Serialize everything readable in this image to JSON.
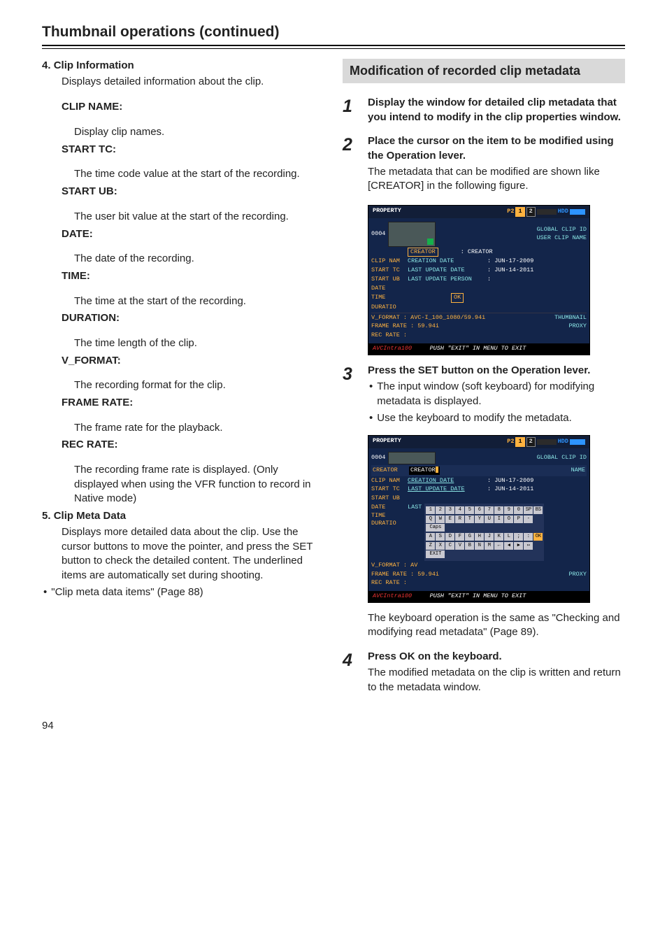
{
  "chapterTitle": "Thumbnail operations (continued)",
  "left": {
    "item4": {
      "num": "4.",
      "title": "Clip Information",
      "desc": "Displays detailed information about the clip.",
      "fields": [
        {
          "label": "CLIP NAME:",
          "text": "Display clip names."
        },
        {
          "label": "START TC:",
          "text": "The time code value at the start of the recording."
        },
        {
          "label": "START UB:",
          "text": "The user bit value at the start of the recording."
        },
        {
          "label": "DATE:",
          "text": "The date of the recording."
        },
        {
          "label": "TIME:",
          "text": "The time at the start of the recording."
        },
        {
          "label": "DURATION:",
          "text": "The time length of the clip."
        },
        {
          "label": "V_FORMAT:",
          "text": "The recording format for the clip."
        },
        {
          "label": "FRAME RATE:",
          "text": "The frame rate for the playback."
        },
        {
          "label": "REC RATE:",
          "text": "The recording frame rate is displayed. (Only displayed when using the VFR function to record in Native mode)"
        }
      ]
    },
    "item5": {
      "num": "5.",
      "title": "Clip Meta Data",
      "desc": "Displays more detailed data about the clip. Use the cursor buttons to move the pointer, and press the SET button to check the detailed content. The underlined items are automatically set during shooting.",
      "bulletText": "\"Clip meta data items\" (Page 88)"
    }
  },
  "right": {
    "sectionHeading": "Modification of recorded clip metadata",
    "steps": {
      "s1": {
        "num": "1",
        "title": "Display the window for detailed clip metadata that you intend to modify in the clip properties window."
      },
      "s2": {
        "num": "2",
        "title": "Place the cursor on the item to be modified using the Operation lever.",
        "para": "The metadata that can be modified are shown like [CREATOR] in the following figure."
      },
      "s3": {
        "num": "3",
        "title": "Press the SET button on the Operation lever.",
        "bullets": [
          "The input window (soft keyboard) for modifying metadata is displayed.",
          "Use the keyboard to modify the metadata."
        ],
        "after": "The keyboard operation is the same as \"Checking and modifying read metadata\" (Page 89)."
      },
      "s4": {
        "num": "4",
        "title": "Press OK on the keyboard.",
        "para": "The modified metadata on the clip is written and return to the metadata window."
      }
    }
  },
  "shot1": {
    "property": "PROPERTY",
    "p2": "P2",
    "slot1": "1",
    "slot2": "2",
    "hdd": "HDD",
    "clipNo": "0004",
    "globalId": "GLOBAL CLIP ID",
    "userClipName": "USER CLIP NAME",
    "creatorBox": "CREATOR",
    "creatorVal": ": CREATOR",
    "rows": [
      {
        "label": "CLIP NAM",
        "field": "CREATION DATE",
        "val": ": JUN-17-2009"
      },
      {
        "label": "START TC",
        "field": "LAST UPDATE DATE",
        "val": ": JUN-14-2011"
      },
      {
        "label": "START UB",
        "field": "LAST UPDATE PERSON",
        "val": ":"
      },
      {
        "label": "DATE",
        "field": "",
        "val": ""
      },
      {
        "label": "TIME",
        "field": "",
        "val": ""
      },
      {
        "label": "DURATIO",
        "field": "",
        "val": ""
      }
    ],
    "ok": "OK",
    "vformat": "V_FORMAT   : AVC-I_100_1080/59.94i",
    "framerate": "FRAME RATE : 59.94i",
    "recrate": "REC RATE   :",
    "thumbnail": "THUMBNAIL",
    "proxy": "PROXY",
    "brand": "AVCIntra100",
    "exitMsg": "PUSH \"EXIT\" IN MENU TO EXIT"
  },
  "shot2": {
    "property": "PROPERTY",
    "p2": "P2",
    "slot1": "1",
    "slot2": "2",
    "hdd": "HDD",
    "clipNo": "0004",
    "globalId": "GLOBAL CLIP ID",
    "nameSuffix": "NAME",
    "creatorLbl": "CREATOR",
    "creatorVal": "CREATOR",
    "rows": [
      {
        "label": "CLIP NAM",
        "field": "CREATION DATE",
        "val": ": JUN-17-2009"
      },
      {
        "label": "START TC",
        "field": "LAST UPDATE DATE",
        "val": ": JUN-14-2011"
      },
      {
        "label": "START UB",
        "field": "",
        "val": ""
      },
      {
        "label": "DATE",
        "field": "LAST",
        "val": ""
      },
      {
        "label": "TIME",
        "field": "",
        "val": ""
      },
      {
        "label": "DURATIO",
        "field": "",
        "val": ""
      }
    ],
    "kbdRow1": [
      "1",
      "2",
      "3",
      "4",
      "5",
      "6",
      "7",
      "8",
      "9",
      "0",
      "SP",
      "BS"
    ],
    "kbdRow2": [
      "Q",
      "W",
      "E",
      "R",
      "T",
      "Y",
      "U",
      "I",
      "O",
      "P",
      "-",
      "Caps"
    ],
    "kbdRow3": [
      "A",
      "S",
      "D",
      "F",
      "G",
      "H",
      "J",
      "K",
      "L",
      ";",
      ":",
      "OK"
    ],
    "kbdRow4": [
      "Z",
      "X",
      "C",
      "V",
      "B",
      "N",
      "M",
      "←",
      "◀",
      "▶",
      "↦",
      "EXIT"
    ],
    "vformat": "V_FORMAT   : AV",
    "framerate": "FRAME RATE : 59.94i",
    "recrate": "REC RATE   :",
    "proxy": "PROXY",
    "brand": "AVCIntra100",
    "exitMsg": "PUSH \"EXIT\" IN MENU TO EXIT"
  },
  "pageNumber": "94"
}
